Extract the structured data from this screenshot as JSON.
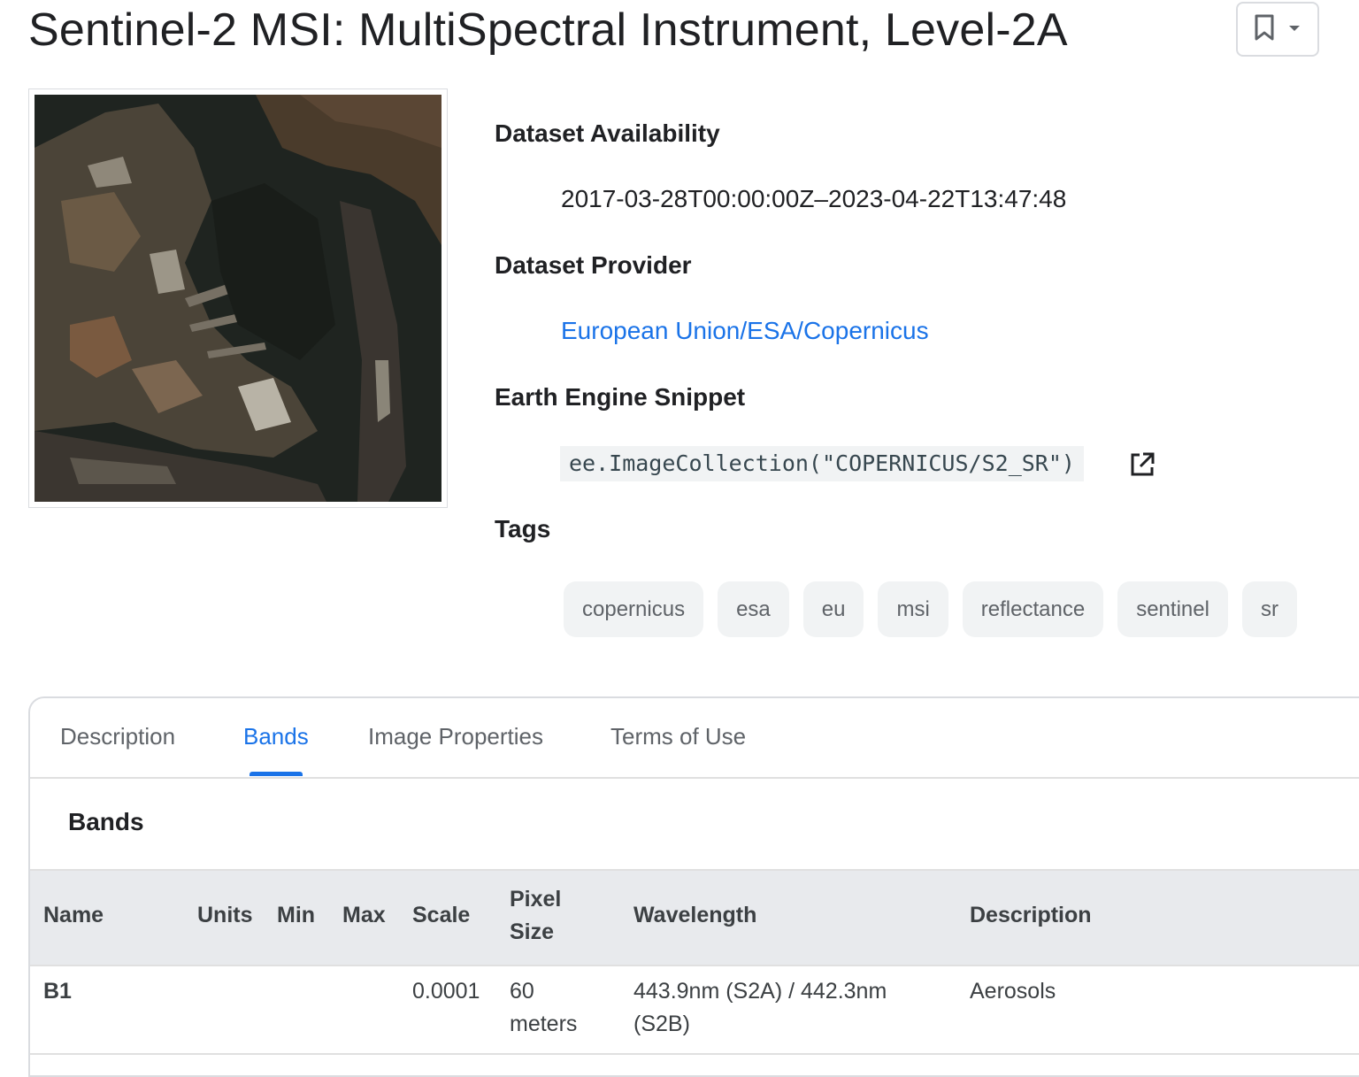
{
  "page": {
    "title": "Sentinel-2 MSI: MultiSpectral Instrument, Level-2A"
  },
  "icons": {
    "bookmark": "bookmark-icon",
    "dropdown": "chevron-down-icon",
    "external_link": "open-in-new-icon"
  },
  "metadata": {
    "availability_label": "Dataset Availability",
    "availability_value": "2017-03-28T00:00:00Z–2023-04-22T13:47:48",
    "provider_label": "Dataset Provider",
    "provider_value": "European Union/ESA/Copernicus",
    "snippet_label": "Earth Engine Snippet",
    "snippet_value": "ee.ImageCollection(\"COPERNICUS/S2_SR\")",
    "tags_label": "Tags",
    "tags": [
      "copernicus",
      "esa",
      "eu",
      "msi",
      "reflectance",
      "sentinel",
      "sr"
    ]
  },
  "tabs": [
    {
      "label": "Description",
      "active": false
    },
    {
      "label": "Bands",
      "active": true
    },
    {
      "label": "Image Properties",
      "active": false
    },
    {
      "label": "Terms of Use",
      "active": false
    }
  ],
  "bands": {
    "heading": "Bands",
    "columns": {
      "name": "Name",
      "units": "Units",
      "min": "Min",
      "max": "Max",
      "scale": "Scale",
      "pixel_size_line1": "Pixel",
      "pixel_size_line2": "Size",
      "wavelength": "Wavelength",
      "description": "Description"
    },
    "rows": [
      {
        "name": "B1",
        "units": "",
        "min": "",
        "max": "",
        "scale": "0.0001",
        "pixel_size_line1": "60",
        "pixel_size_line2": "meters",
        "wavelength_line1": "443.9nm (S2A) / 442.3nm",
        "wavelength_line2": "(S2B)",
        "description": "Aerosols"
      }
    ]
  },
  "colors": {
    "accent": "#1a73e8",
    "text": "#202124",
    "muted": "#5f6368",
    "chip_bg": "#f1f3f4",
    "table_header_bg": "#e8eaed"
  }
}
